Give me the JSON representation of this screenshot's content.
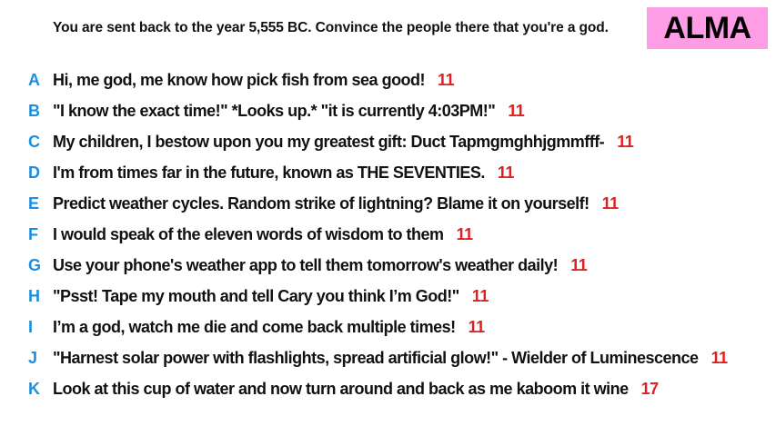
{
  "prompt": "You are sent back to the year 5,555 BC. Convince the people there that you're a god.",
  "player_name": "ALMA",
  "colors": {
    "letter": "#1a8fe0",
    "score": "#e02020",
    "badge_bg": "#ff9ce6"
  },
  "answers": [
    {
      "letter": "A",
      "text": "Hi, me god, me know how pick fish from sea good!",
      "score": "11"
    },
    {
      "letter": "B",
      "text": "\"I know the exact time!\" *Looks up.* \"it is currently 4:03PM!\"",
      "score": "11"
    },
    {
      "letter": "C",
      "text": "My children, I bestow upon you my greatest gift: Duct Tapmgmghhjgmmfff-",
      "score": "11"
    },
    {
      "letter": "D",
      "text": "I'm from times far in the future, known as THE SEVENTIES.",
      "score": "11"
    },
    {
      "letter": "E",
      "text": "Predict weather cycles. Random strike of lightning? Blame it on yourself!",
      "score": "11"
    },
    {
      "letter": "F",
      "text": "I would speak of the eleven words of wisdom to them",
      "score": "11"
    },
    {
      "letter": "G",
      "text": "Use your phone's weather app to tell them tomorrow's weather daily!",
      "score": "11"
    },
    {
      "letter": "H",
      "text": "\"Psst! Tape my mouth and tell Cary you think I’m God!\"",
      "score": "11"
    },
    {
      "letter": "I",
      "text": "I’m a god, watch me die and come back multiple times!",
      "score": "11"
    },
    {
      "letter": "J",
      "text": "\"Harnest solar power with flashlights, spread artificial glow!\" - Wielder of Luminescence",
      "score": "11"
    },
    {
      "letter": "K",
      "text": "Look at this cup of water and now turn around and back as me kaboom it wine",
      "score": "17"
    }
  ]
}
